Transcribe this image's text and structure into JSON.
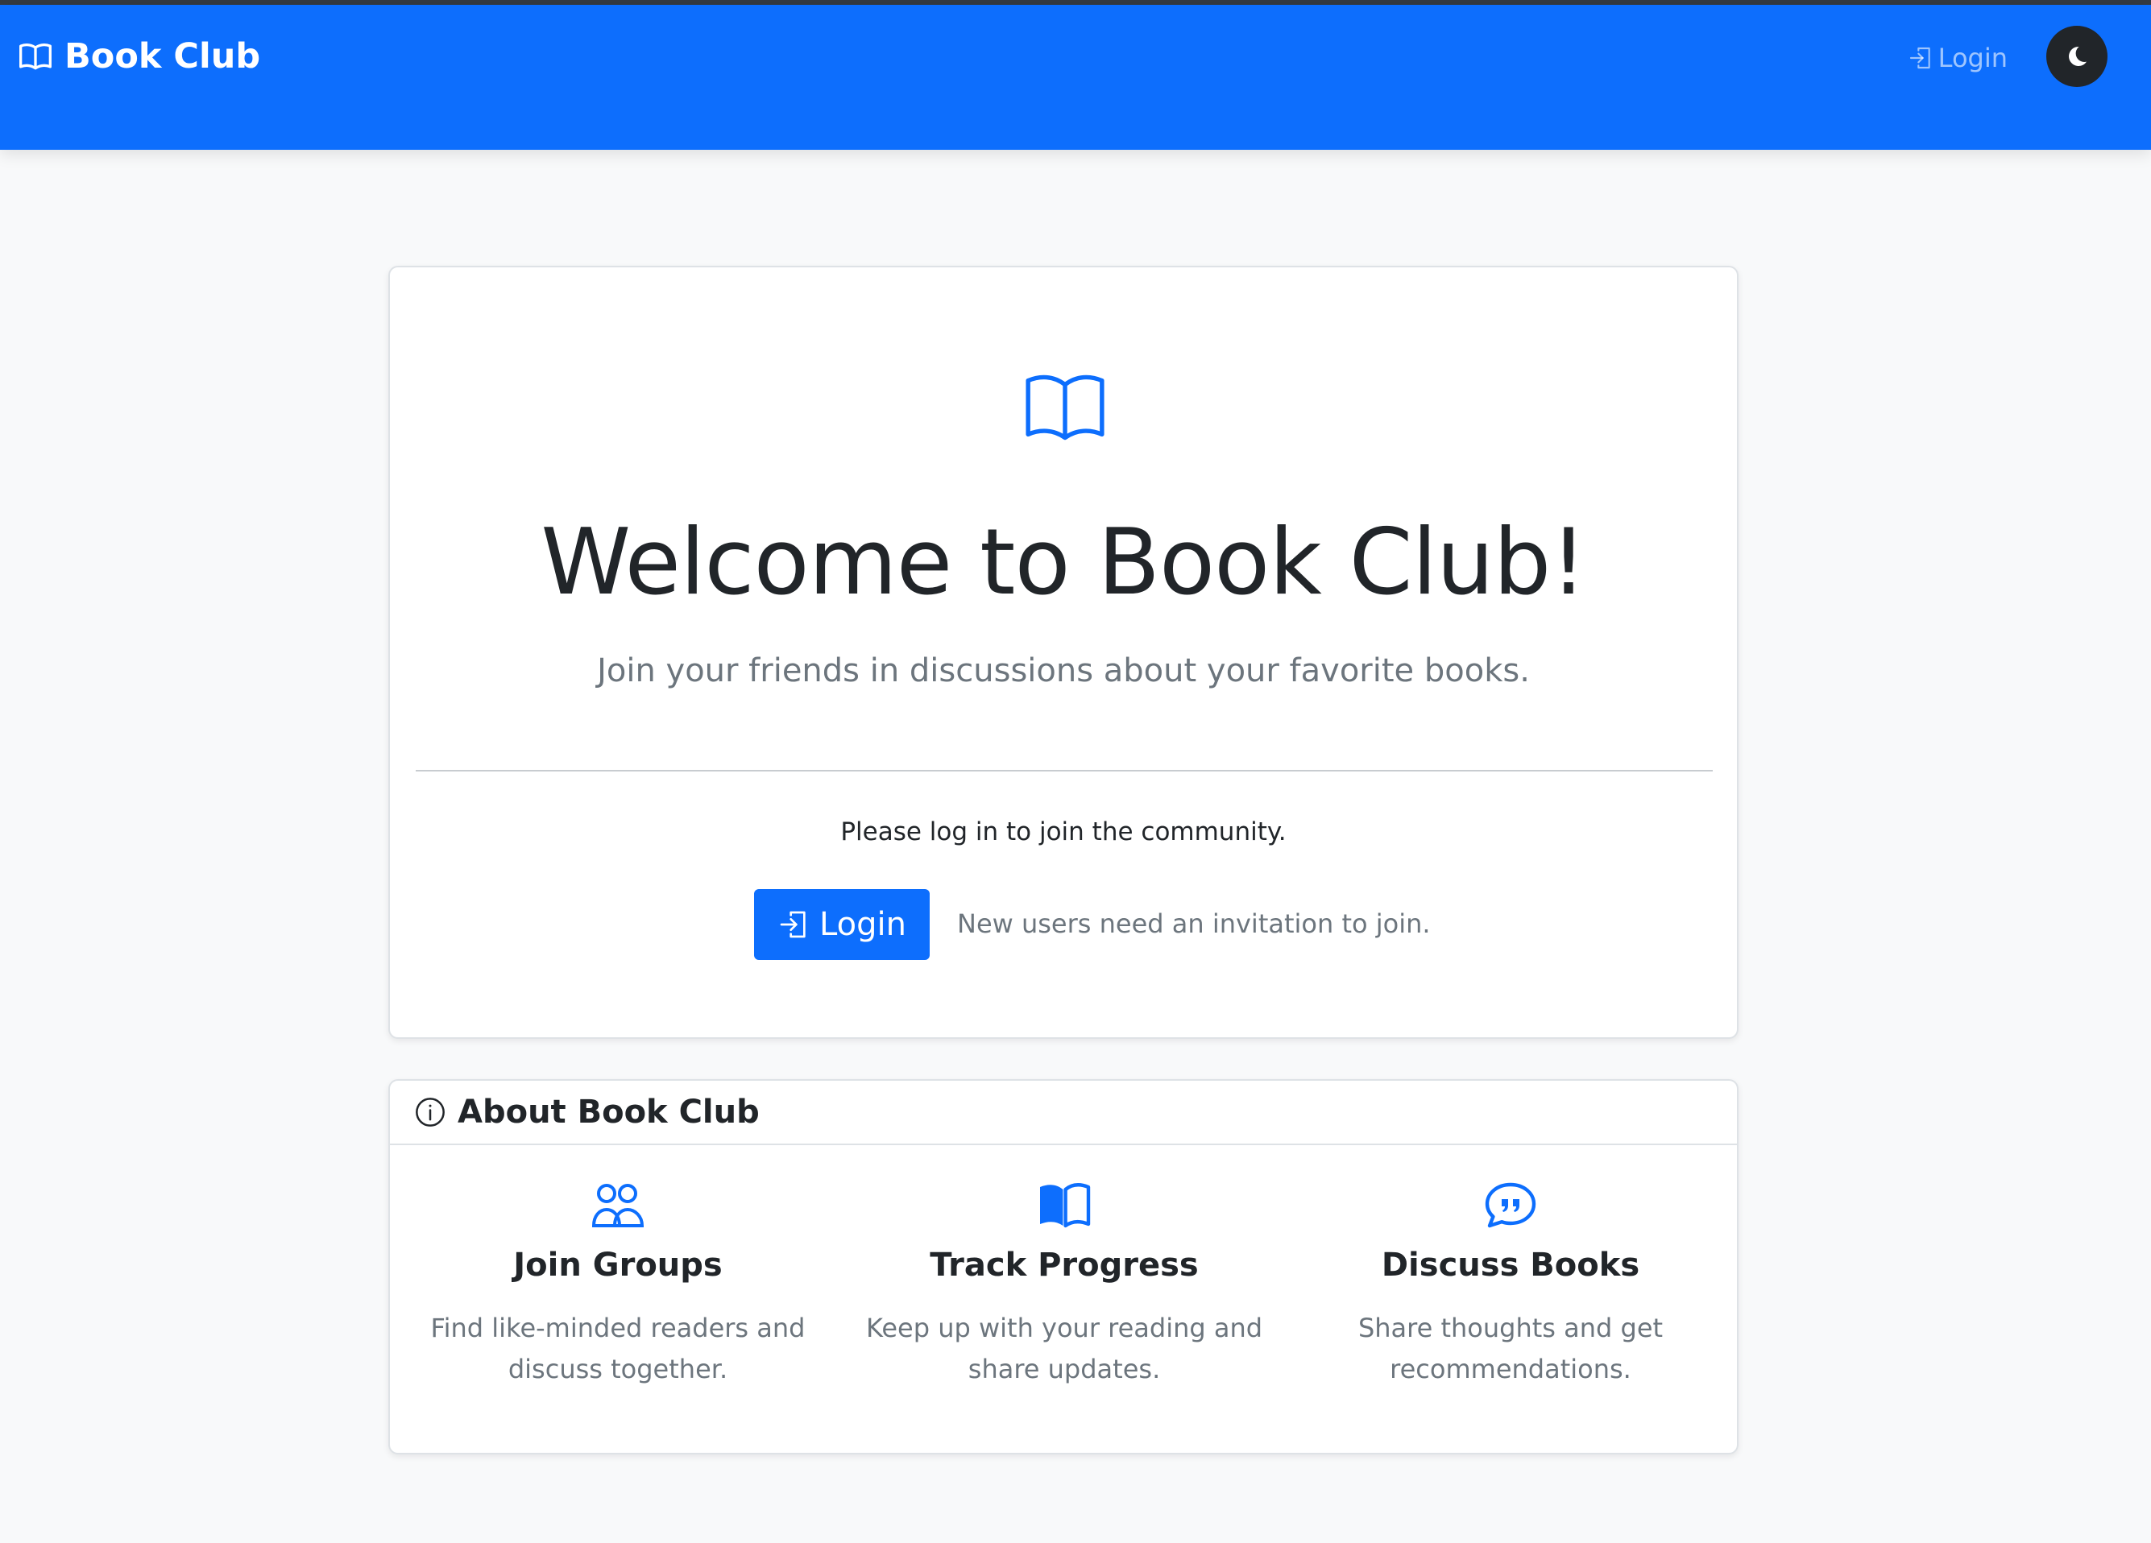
{
  "navbar": {
    "brand": "Book Club",
    "login_label": "Login",
    "theme_toggle_icon": "moon-icon",
    "background": "#0d6efd"
  },
  "welcome": {
    "icon": "book-icon",
    "title": "Welcome to Book Club!",
    "lead": "Join your friends in discussions about your favorite books.",
    "prompt": "Please log in to join the community.",
    "login_button": "Login",
    "invite_note": "New users need an invitation to join."
  },
  "about": {
    "icon": "info-circle-icon",
    "title": "About Book Club",
    "features": [
      {
        "icon": "people-icon",
        "title": "Join Groups",
        "text": "Find like-minded readers and discuss together."
      },
      {
        "icon": "book-filled-icon",
        "title": "Track Progress",
        "text": "Keep up with your reading and share updates."
      },
      {
        "icon": "chat-quote-icon",
        "title": "Discuss Books",
        "text": "Share thoughts and get recommendations."
      }
    ]
  },
  "colors": {
    "primary": "#0d6efd",
    "text": "#212529",
    "muted": "#6c757d",
    "page_background": "#f8f9fa"
  }
}
